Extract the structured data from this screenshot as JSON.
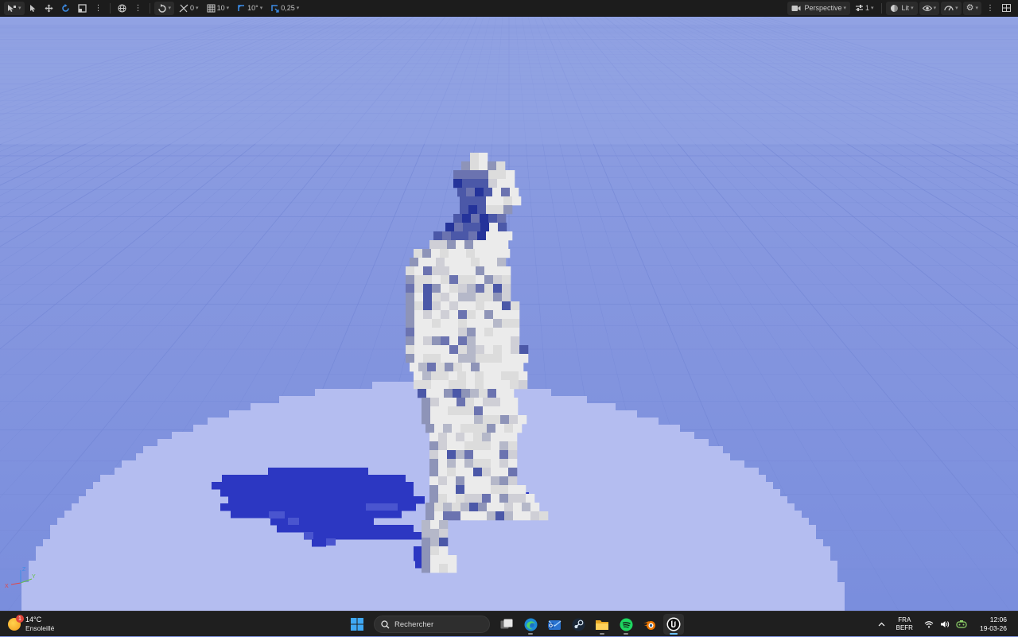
{
  "toolbar": {
    "translate_snap_value": "0",
    "grid_snap_value": "10",
    "rotation_snap_value": "10°",
    "scale_snap_value": "0,25",
    "view_mode_label": "Perspective",
    "camera_speed_label": "1",
    "lighting_mode_label": "Lit"
  },
  "viewport": {
    "gizmo_x": "X",
    "gizmo_y": "Y",
    "gizmo_z": "Z",
    "colors": {
      "floor": "#b4bdf0",
      "shadow": "#2c37c2",
      "figure_light": "#ebebeb",
      "figure_dark": "#24339a"
    }
  },
  "taskbar": {
    "weather_temp": "14°C",
    "weather_desc": "Ensoleillé",
    "weather_badge": "1",
    "search_placeholder": "Rechercher",
    "lang_primary": "FRA",
    "lang_secondary": "BEFR",
    "time": "12:06",
    "date": "19-03-26"
  }
}
